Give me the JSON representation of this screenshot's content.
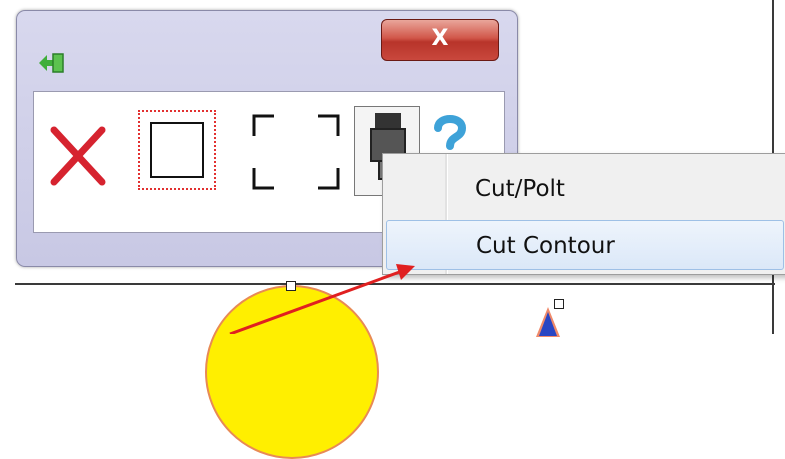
{
  "window": {
    "close_label": "X"
  },
  "context_menu": {
    "items": [
      {
        "label": "Cut/Polt"
      },
      {
        "label": "Cut Contour"
      }
    ],
    "highlighted_index": 1
  },
  "icons": {
    "app": "green-export-icon",
    "delete": "red-x-icon",
    "rectangle": "rectangle-selection-icon",
    "select": "dashed-corners-icon",
    "cutter": "cutter-device-icon",
    "help": "question-icon"
  },
  "colors": {
    "close_button": "#c9483d",
    "menu_highlight": "#dbe8f8",
    "arrow": "#e02020",
    "circle_fill": "#ffef00",
    "triangle_fill": "#2946c4"
  }
}
